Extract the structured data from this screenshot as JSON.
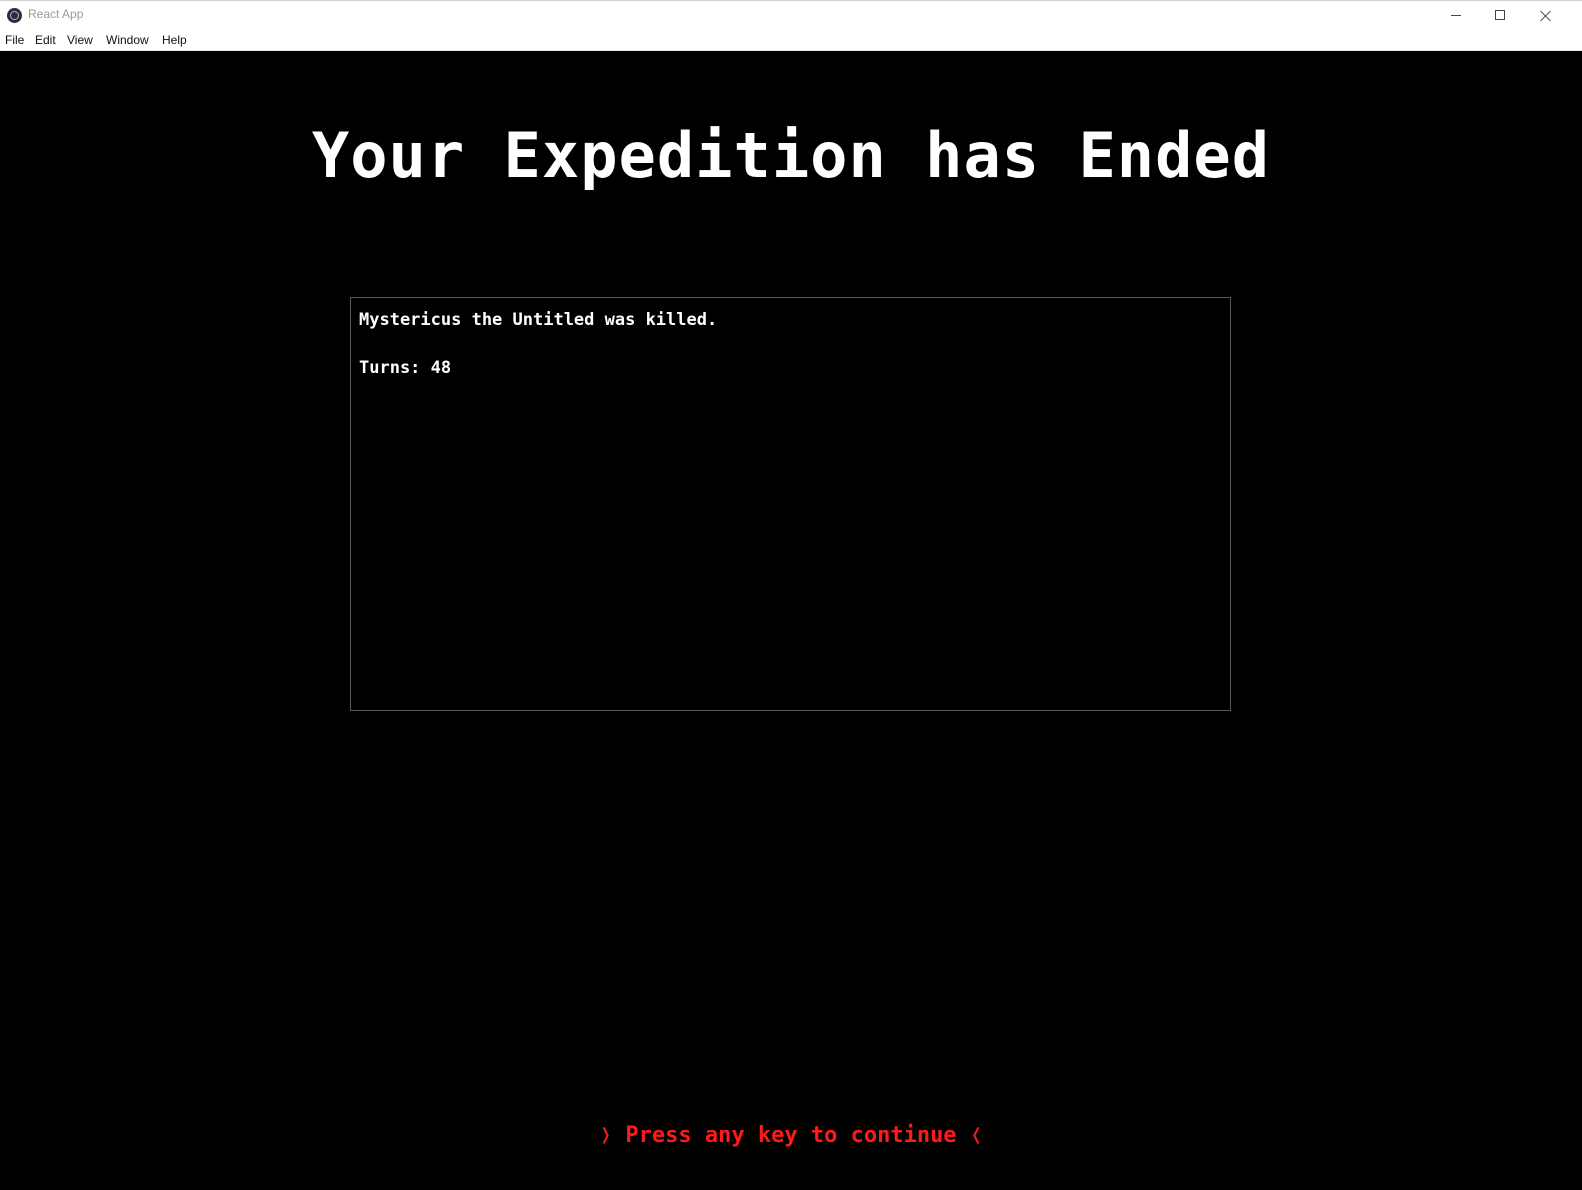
{
  "window": {
    "title": "React App",
    "icon": "electron-icon"
  },
  "menu": {
    "items": [
      "File",
      "Edit",
      "View",
      "Window",
      "Help"
    ]
  },
  "screen": {
    "heading": "Your Expedition has Ended",
    "summary": {
      "death_line": "Mystericus the Untitled was killed.",
      "turns_line": "Turns: 48"
    },
    "prompt": "❭ Press any key to continue ❬"
  },
  "colors": {
    "background": "#000000",
    "text": "#ffffff",
    "prompt": "#ff1a1a",
    "border": "#5a5a5a"
  }
}
